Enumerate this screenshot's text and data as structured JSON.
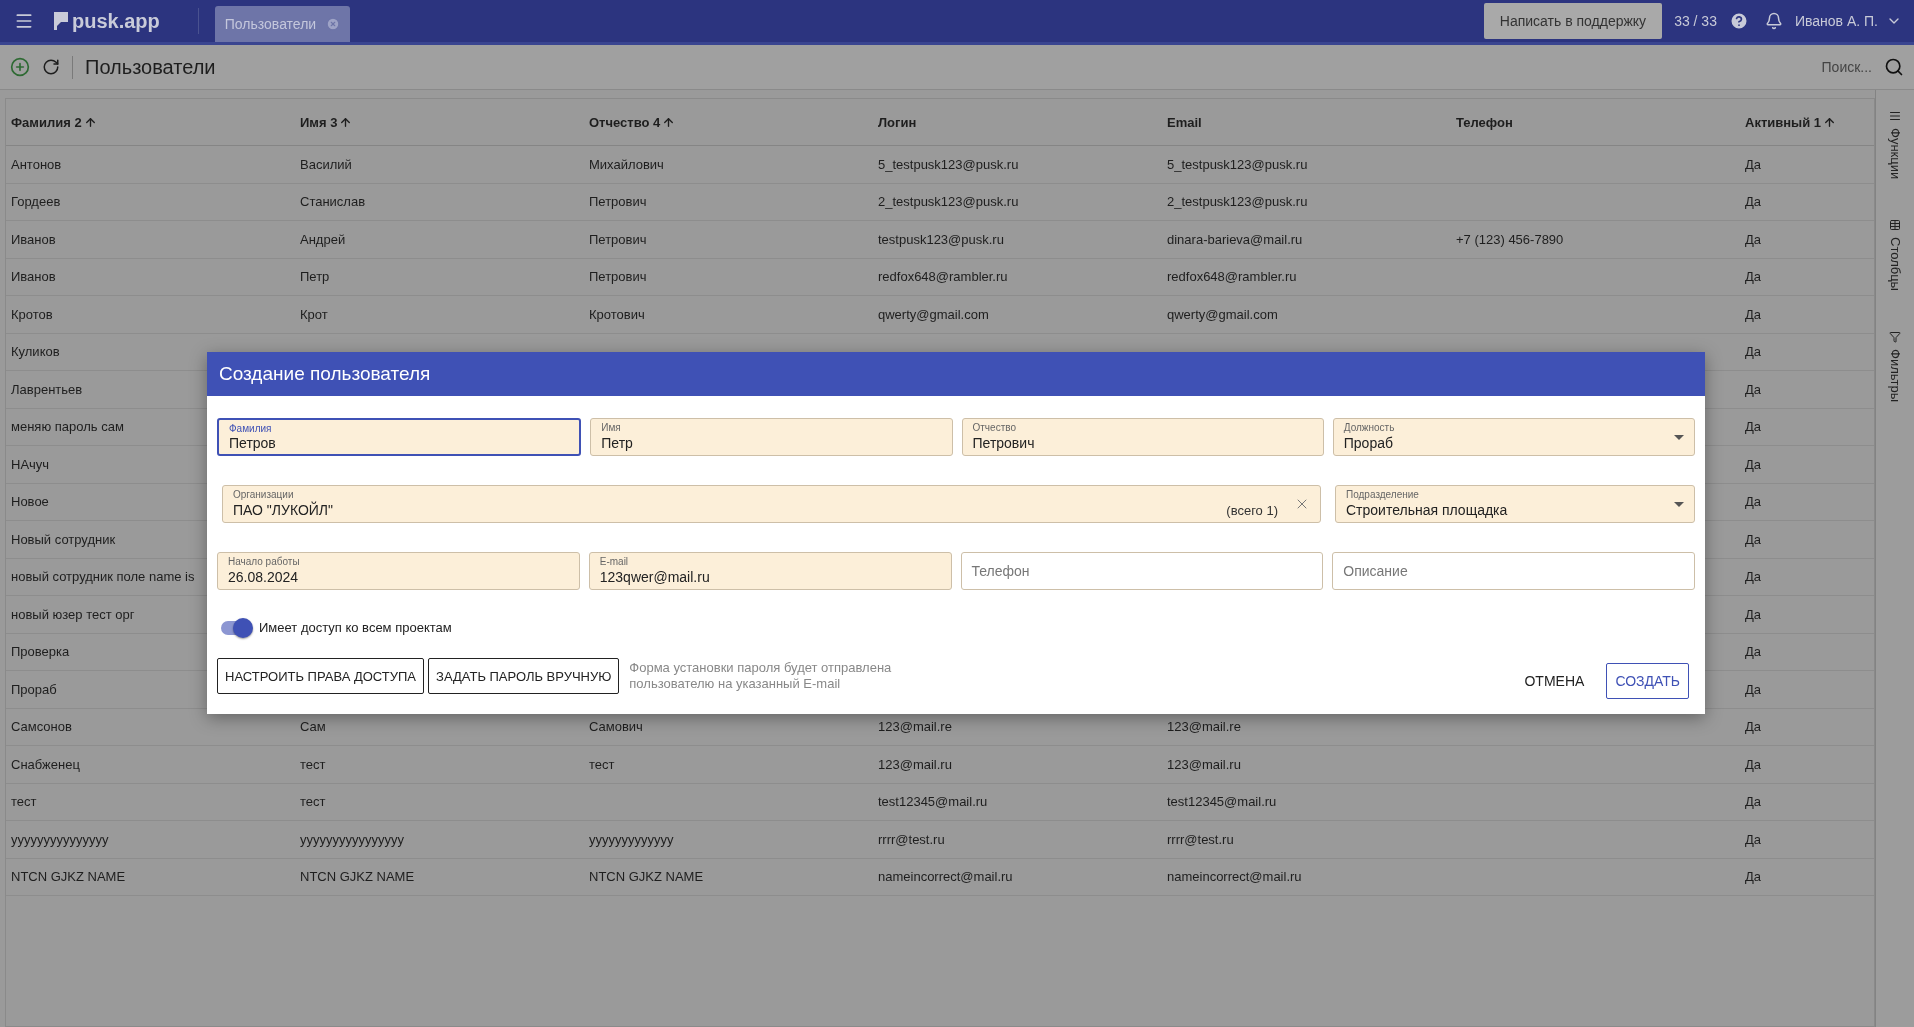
{
  "topbar": {
    "app_name": "pusk.app",
    "tabs": [
      {
        "label": "Пользователи",
        "selected": true
      }
    ],
    "support_button": "Написать в поддержку",
    "counter": "33 / 33",
    "user": "Иванов А. П."
  },
  "toolbar": {
    "title": "Пользователи",
    "search": {
      "placeholder": "Поиск..."
    }
  },
  "table": {
    "columns": [
      {
        "label": "Фамилия 2",
        "sorted": true
      },
      {
        "label": "Имя 3",
        "sorted": true
      },
      {
        "label": "Отчество 4",
        "sorted": true
      },
      {
        "label": "Логин",
        "sorted": false
      },
      {
        "label": "Email",
        "sorted": false
      },
      {
        "label": "Телефон",
        "sorted": false
      },
      {
        "label": "Активный 1",
        "sorted": true
      }
    ],
    "rows": [
      [
        "Антонов",
        "Василий",
        "Михайлович",
        "5_testpusk123@pusk.ru",
        "5_testpusk123@pusk.ru",
        null,
        "Да"
      ],
      [
        "Гордеев",
        "Станислав",
        "Петрович",
        "2_testpusk123@pusk.ru",
        "2_testpusk123@pusk.ru",
        null,
        "Да"
      ],
      [
        "Иванов",
        "Андрей",
        "Петрович",
        "testpusk123@pusk.ru",
        "dinara-barieva@mail.ru",
        "+7 (123) 456-7890",
        "Да"
      ],
      [
        "Иванов",
        "Петр",
        "Петрович",
        "redfox648@rambler.ru",
        "redfox648@rambler.ru",
        null,
        "Да"
      ],
      [
        "Кротов",
        "Крот",
        "Кротович",
        "qwerty@gmail.com",
        "qwerty@gmail.com",
        null,
        "Да"
      ],
      [
        "Куликов",
        null,
        null,
        null,
        null,
        null,
        "Да"
      ],
      [
        "Лаврентьев",
        null,
        null,
        null,
        null,
        null,
        "Да"
      ],
      [
        "меняю пароль сам",
        null,
        null,
        null,
        null,
        null,
        "Да"
      ],
      [
        "НАчуч",
        null,
        null,
        null,
        null,
        null,
        "Да"
      ],
      [
        "Новое",
        null,
        null,
        null,
        null,
        null,
        "Да"
      ],
      [
        "Новый сотрудник",
        null,
        null,
        null,
        null,
        null,
        "Да"
      ],
      [
        "новый сотрудник поле name is",
        null,
        null,
        null,
        null,
        null,
        "Да"
      ],
      [
        "новый юзер тест орг",
        null,
        null,
        null,
        null,
        null,
        "Да"
      ],
      [
        "Проверка",
        null,
        null,
        null,
        null,
        null,
        "Да"
      ],
      [
        "Прораб",
        null,
        null,
        null,
        null,
        null,
        "Да"
      ],
      [
        "Самсонов",
        "Сам",
        "Самович",
        "123@mail.re",
        "123@mail.re",
        null,
        "Да"
      ],
      [
        "Снабженец",
        "тест",
        "тест",
        "123@mail.ru",
        "123@mail.ru",
        null,
        "Да"
      ],
      [
        "тест",
        "тест",
        null,
        "test12345@mail.ru",
        "test12345@mail.ru",
        null,
        "Да"
      ],
      [
        "yyyyyyyyyyyyyyy",
        "yyyyyyyyyyyyyyyy",
        "yyyyyyyyyyyyy",
        "rrrr@test.ru",
        "rrrr@test.ru",
        null,
        "Да"
      ],
      [
        "NTCN GJKZ NAME",
        "NTCN GJKZ NAME",
        "NTCN GJKZ NAME",
        "nameincorrect@mail.ru",
        "nameincorrect@mail.ru",
        null,
        "Да"
      ]
    ]
  },
  "side_panel": {
    "items": [
      {
        "kind": "functions",
        "label": "Функции"
      },
      {
        "kind": "columns",
        "label": "Столбцы"
      },
      {
        "kind": "filters",
        "label": "Фильтры"
      }
    ]
  },
  "dialog": {
    "title": "Создание пользователя",
    "field_rows": [
      [
        {
          "kind": "text",
          "label": "Фамилия",
          "value": "Петров",
          "focused": true
        },
        {
          "kind": "text",
          "label": "Имя",
          "value": "Петр",
          "focused": false
        },
        {
          "kind": "text",
          "label": "Отчество",
          "value": "Петрович",
          "focused": false
        },
        {
          "kind": "select",
          "label": "Должность",
          "value": "Прораб",
          "focused": false
        }
      ],
      [
        {
          "kind": "multiselect",
          "label": "Организации",
          "value": "ПАО \"ЛУКОЙЛ\"",
          "count": "(всего 1)",
          "focused": false
        },
        {
          "kind": "select",
          "label": "Подразделение",
          "value": "Строительная площадка",
          "focused": false
        }
      ],
      [
        {
          "kind": "text",
          "label": "Начало работы",
          "value": "26.08.2024",
          "focused": false
        },
        {
          "kind": "text",
          "label": "E-mail",
          "value": "123qwer@mail.ru",
          "focused": false
        },
        {
          "kind": "text",
          "placeholder": "Телефон",
          "focused": false
        },
        {
          "kind": "text",
          "placeholder": "Описание",
          "focused": false
        }
      ]
    ],
    "toggle": {
      "label": "Имеет доступ ко всем проектам",
      "on": true
    },
    "buttons": [
      "НАСТРОИТЬ ПРАВА ДОСТУПА",
      "ЗАДАТЬ ПАРОЛЬ ВРУЧНУЮ"
    ],
    "note": "Форма установки пароля будет отправлена пользователю на указанный E-mail",
    "cancel": "ОТМЕНА",
    "submit": "СОЗДАТЬ"
  }
}
